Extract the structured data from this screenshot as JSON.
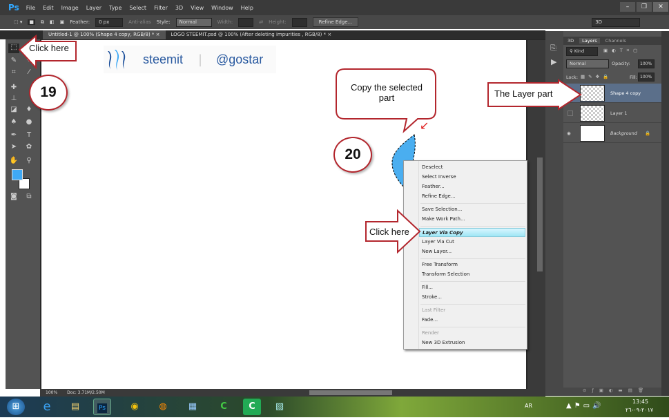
{
  "app": {
    "logo": "Ps",
    "menu": [
      "File",
      "Edit",
      "Image",
      "Layer",
      "Type",
      "Select",
      "Filter",
      "3D",
      "View",
      "Window",
      "Help"
    ],
    "workspace": "3D"
  },
  "options": {
    "feather_label": "Feather:",
    "feather_value": "0 px",
    "antialias": "Anti-alias",
    "style_label": "Style:",
    "style_value": "Normal",
    "width_label": "Width:",
    "height_label": "Height:",
    "refine_button": "Refine Edge..."
  },
  "tabs": [
    {
      "label": "Untitled-1 @ 100% (Shape 4 copy, RGB/8) *  ×"
    },
    {
      "label": "LOGO STEEMIT.psd @ 100% (After deleting  impurities , RGB/8) *  ×"
    }
  ],
  "canvas": {
    "brand": "steemit",
    "separator": "|",
    "handle": "@gostar",
    "shape_color": "#4aaef0"
  },
  "colors": {
    "foreground": "#3fa9f5",
    "background": "#ffffff",
    "accent": "#b3262d"
  },
  "context_menu": {
    "items": [
      "Deselect",
      "Select Inverse",
      "Feather...",
      "Refine Edge...",
      "Save Selection...",
      "Make Work Path...",
      "Layer Via Copy",
      "Layer Via Cut",
      "New Layer...",
      "Free Transform",
      "Transform Selection",
      "Fill...",
      "Stroke...",
      "Last Filter",
      "Fade...",
      "Render",
      "New 3D Extrusion"
    ],
    "highlighted": "Layer Via Copy",
    "disabled": [
      "Last Filter",
      "Render"
    ]
  },
  "layers_panel": {
    "tabs": [
      "3D",
      "Layers",
      "Channels"
    ],
    "kind": "Kind",
    "blend": "Normal",
    "opacity_label": "Opacity:",
    "opacity": "100%",
    "lock_label": "Lock:",
    "fill_label": "Fill:",
    "fill": "100%",
    "layers": [
      {
        "name": "Shape 4 copy",
        "selected": true
      },
      {
        "name": "Layer 1"
      },
      {
        "name": "Background"
      }
    ]
  },
  "status": {
    "zoom": "100%",
    "doc": "Doc: 3.71M/2.50M"
  },
  "annotations": {
    "click_here_1": "Click here",
    "step19": "19",
    "step20": "20",
    "copy_bubble": "Copy the selected part",
    "click_here_2": "Click here",
    "layer_part": "The Layer part"
  },
  "taskbar": {
    "lang": "AR",
    "time": "13:45",
    "date": "٢٠١٧-٠٩-٢٦"
  }
}
